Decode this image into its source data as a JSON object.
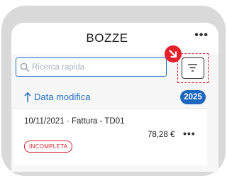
{
  "header": {
    "title": "BOZZE",
    "menu_icon": "more-horizontal-icon"
  },
  "search": {
    "placeholder": "Ricerca rapida",
    "value": "",
    "icon": "search-icon"
  },
  "filter": {
    "icon": "filter-lines-icon",
    "highlight_color": "#d9232f",
    "pointer_icon": "arrow-down-right-icon"
  },
  "sort": {
    "icon": "arrow-up-icon",
    "label": "Data modifica"
  },
  "year": "2025",
  "documents": [
    {
      "date": "10/11/2021",
      "separator": "·",
      "type": "Fattura - TD01",
      "amount": "78,28 €",
      "status": "INCOMPLETA"
    }
  ],
  "colors": {
    "accent": "#1f6fc4",
    "alert": "#e3202b"
  }
}
